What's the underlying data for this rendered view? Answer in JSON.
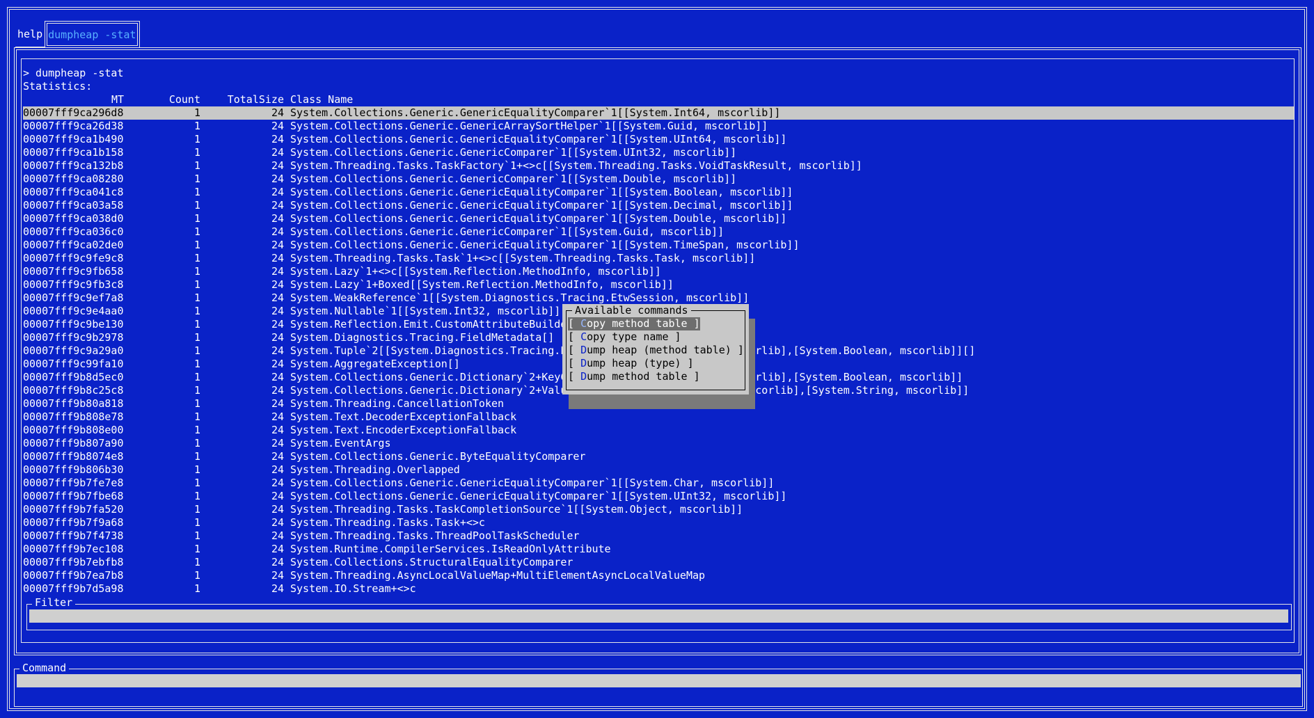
{
  "tabs": [
    {
      "label": "help",
      "active": false
    },
    {
      "label": "dumpheap -stat",
      "active": true
    }
  ],
  "console": {
    "prompt_line": "> dumpheap -stat",
    "statistics_label": "Statistics:"
  },
  "table": {
    "headers": {
      "mt": "MT",
      "count": "Count",
      "total_size": "TotalSize",
      "class_name": "Class Name"
    },
    "selected_index": 0,
    "rows": [
      {
        "mt": "00007fff9ca296d8",
        "count": "1",
        "size": "24",
        "cls": "System.Collections.Generic.GenericEqualityComparer`1[[System.Int64, mscorlib]]"
      },
      {
        "mt": "00007fff9ca26d38",
        "count": "1",
        "size": "24",
        "cls": "System.Collections.Generic.GenericArraySortHelper`1[[System.Guid, mscorlib]]"
      },
      {
        "mt": "00007fff9ca1b490",
        "count": "1",
        "size": "24",
        "cls": "System.Collections.Generic.GenericEqualityComparer`1[[System.UInt64, mscorlib]]"
      },
      {
        "mt": "00007fff9ca1b158",
        "count": "1",
        "size": "24",
        "cls": "System.Collections.Generic.GenericComparer`1[[System.UInt32, mscorlib]]"
      },
      {
        "mt": "00007fff9ca132b8",
        "count": "1",
        "size": "24",
        "cls": "System.Threading.Tasks.TaskFactory`1+<>c[[System.Threading.Tasks.VoidTaskResult, mscorlib]]"
      },
      {
        "mt": "00007fff9ca08280",
        "count": "1",
        "size": "24",
        "cls": "System.Collections.Generic.GenericComparer`1[[System.Double, mscorlib]]"
      },
      {
        "mt": "00007fff9ca041c8",
        "count": "1",
        "size": "24",
        "cls": "System.Collections.Generic.GenericEqualityComparer`1[[System.Boolean, mscorlib]]"
      },
      {
        "mt": "00007fff9ca03a58",
        "count": "1",
        "size": "24",
        "cls": "System.Collections.Generic.GenericEqualityComparer`1[[System.Decimal, mscorlib]]"
      },
      {
        "mt": "00007fff9ca038d0",
        "count": "1",
        "size": "24",
        "cls": "System.Collections.Generic.GenericEqualityComparer`1[[System.Double, mscorlib]]"
      },
      {
        "mt": "00007fff9ca036c0",
        "count": "1",
        "size": "24",
        "cls": "System.Collections.Generic.GenericComparer`1[[System.Guid, mscorlib]]"
      },
      {
        "mt": "00007fff9ca02de0",
        "count": "1",
        "size": "24",
        "cls": "System.Collections.Generic.GenericEqualityComparer`1[[System.TimeSpan, mscorlib]]"
      },
      {
        "mt": "00007fff9c9fe9c8",
        "count": "1",
        "size": "24",
        "cls": "System.Threading.Tasks.Task`1+<>c[[System.Threading.Tasks.Task, mscorlib]]"
      },
      {
        "mt": "00007fff9c9fb658",
        "count": "1",
        "size": "24",
        "cls": "System.Lazy`1+<>c[[System.Reflection.MethodInfo, mscorlib]]"
      },
      {
        "mt": "00007fff9c9fb3c8",
        "count": "1",
        "size": "24",
        "cls": "System.Lazy`1+Boxed[[System.Reflection.MethodInfo, mscorlib]]"
      },
      {
        "mt": "00007fff9c9ef7a8",
        "count": "1",
        "size": "24",
        "cls": "System.WeakReference`1[[System.Diagnostics.Tracing.EtwSession, mscorlib]]"
      },
      {
        "mt": "00007fff9c9e4aa0",
        "count": "1",
        "size": "24",
        "cls": "System.Nullable`1[[System.Int32, mscorlib]][]"
      },
      {
        "mt": "00007fff9c9be130",
        "count": "1",
        "size": "24",
        "cls": "System.Reflection.Emit.CustomAttributeBuilder[]"
      },
      {
        "mt": "00007fff9c9b2978",
        "count": "1",
        "size": "24",
        "cls": "System.Diagnostics.Tracing.FieldMetadata[]"
      },
      {
        "mt": "00007fff9c9a29a0",
        "count": "1",
        "size": "24",
        "cls": "System.Tuple`2[[System.Diagnostics.Tracing.EventProvider+SessionInfo, mscorlib],[System.Boolean, mscorlib]][]"
      },
      {
        "mt": "00007fff9c99fa10",
        "count": "1",
        "size": "24",
        "cls": "System.AggregateException[]"
      },
      {
        "mt": "00007fff9b8d5ec0",
        "count": "1",
        "size": "24",
        "cls": "System.Collections.Generic.Dictionary`2+KeyCollection[[System.String, mscorlib],[System.Boolean, mscorlib]]"
      },
      {
        "mt": "00007fff9b8c25c8",
        "count": "1",
        "size": "24",
        "cls": "System.Collections.Generic.Dictionary`2+ValueCollection[[System.String, mscorlib],[System.String, mscorlib]]"
      },
      {
        "mt": "00007fff9b80a818",
        "count": "1",
        "size": "24",
        "cls": "System.Threading.CancellationToken"
      },
      {
        "mt": "00007fff9b808e78",
        "count": "1",
        "size": "24",
        "cls": "System.Text.DecoderExceptionFallback"
      },
      {
        "mt": "00007fff9b808e00",
        "count": "1",
        "size": "24",
        "cls": "System.Text.EncoderExceptionFallback"
      },
      {
        "mt": "00007fff9b807a90",
        "count": "1",
        "size": "24",
        "cls": "System.EventArgs"
      },
      {
        "mt": "00007fff9b8074e8",
        "count": "1",
        "size": "24",
        "cls": "System.Collections.Generic.ByteEqualityComparer"
      },
      {
        "mt": "00007fff9b806b30",
        "count": "1",
        "size": "24",
        "cls": "System.Threading.Overlapped"
      },
      {
        "mt": "00007fff9b7fe7e8",
        "count": "1",
        "size": "24",
        "cls": "System.Collections.Generic.GenericEqualityComparer`1[[System.Char, mscorlib]]"
      },
      {
        "mt": "00007fff9b7fbe68",
        "count": "1",
        "size": "24",
        "cls": "System.Collections.Generic.GenericEqualityComparer`1[[System.UInt32, mscorlib]]"
      },
      {
        "mt": "00007fff9b7fa520",
        "count": "1",
        "size": "24",
        "cls": "System.Threading.Tasks.TaskCompletionSource`1[[System.Object, mscorlib]]"
      },
      {
        "mt": "00007fff9b7f9a68",
        "count": "1",
        "size": "24",
        "cls": "System.Threading.Tasks.Task+<>c"
      },
      {
        "mt": "00007fff9b7f4738",
        "count": "1",
        "size": "24",
        "cls": "System.Threading.Tasks.ThreadPoolTaskScheduler"
      },
      {
        "mt": "00007fff9b7ec108",
        "count": "1",
        "size": "24",
        "cls": "System.Runtime.CompilerServices.IsReadOnlyAttribute"
      },
      {
        "mt": "00007fff9b7ebfb8",
        "count": "1",
        "size": "24",
        "cls": "System.Collections.StructuralEqualityComparer"
      },
      {
        "mt": "00007fff9b7ea7b8",
        "count": "1",
        "size": "24",
        "cls": "System.Threading.AsyncLocalValueMap+MultiElementAsyncLocalValueMap"
      },
      {
        "mt": "00007fff9b7d5a98",
        "count": "1",
        "size": "24",
        "cls": "System.IO.Stream+<>c"
      }
    ]
  },
  "filter": {
    "title": "Filter",
    "value": ""
  },
  "command": {
    "title": "Command",
    "value": ""
  },
  "popup": {
    "title": "Available commands",
    "items": [
      {
        "bracket_open": "[ ",
        "hot": "C",
        "rest": "opy method table",
        "bracket_close": " ]",
        "focused": true
      },
      {
        "bracket_open": "[ ",
        "hot": "C",
        "rest": "opy type name",
        "bracket_close": " ]",
        "focused": false
      },
      {
        "bracket_open": "[ ",
        "hot": "D",
        "rest": "ump heap (method table)",
        "bracket_close": " ]",
        "focused": false
      },
      {
        "bracket_open": "[ ",
        "hot": "D",
        "rest": "ump heap (type)",
        "bracket_close": " ]",
        "focused": false
      },
      {
        "bracket_open": "[ ",
        "hot": "D",
        "rest": "ump method table",
        "bracket_close": " ]",
        "focused": false
      }
    ]
  },
  "colors": {
    "background": "#0a22c8",
    "foreground": "#ffffff",
    "active_tab": "#58b0ff",
    "selection": "#c8c8c8",
    "popup_bg": "#c8c8c8",
    "popup_focus": "#6e6e6e",
    "input_bg": "#cfcfcf"
  }
}
